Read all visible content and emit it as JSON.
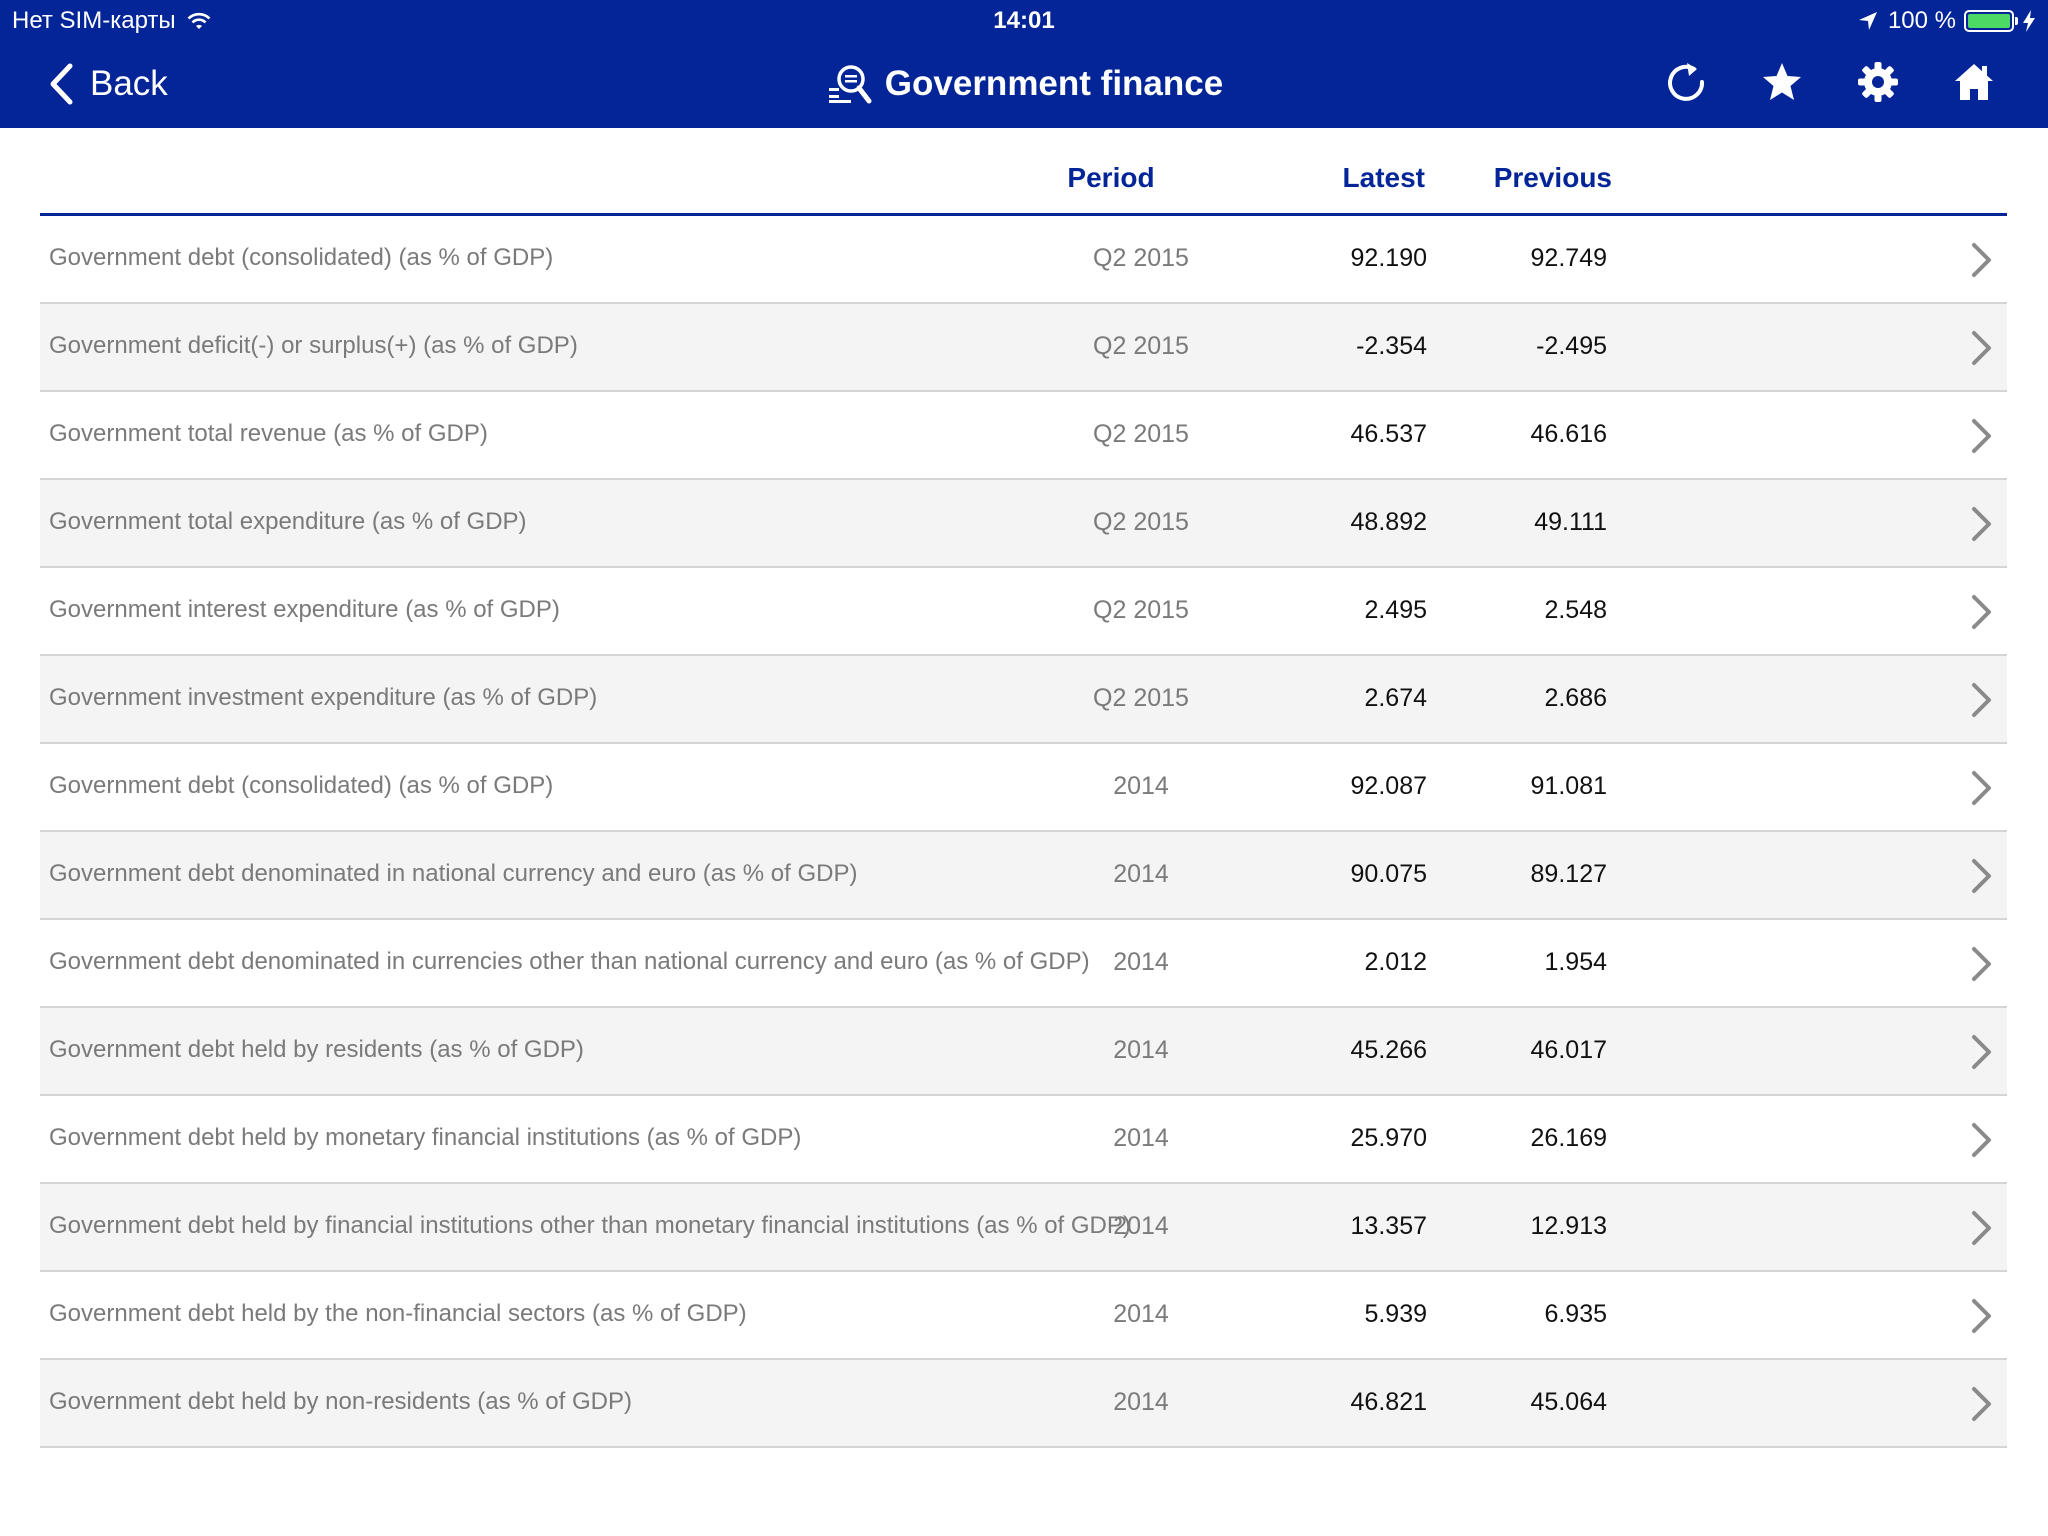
{
  "status_bar": {
    "carrier": "Нет SIM-карты",
    "time": "14:01",
    "battery": "100 %",
    "icons": [
      "wifi-icon",
      "location-arrow-icon",
      "battery-icon",
      "charging-bolt-icon"
    ]
  },
  "nav": {
    "back_label": "Back",
    "title": "Government finance",
    "icons": [
      "back-chevron-icon",
      "search-data-icon",
      "refresh-icon",
      "star-icon",
      "gear-icon",
      "home-icon"
    ]
  },
  "colors": {
    "brand": "#032597",
    "header_text": "#032597",
    "battery": "#4cd964",
    "row_alt": "#f4f4f4"
  },
  "table": {
    "columns": {
      "period": "Period",
      "latest": "Latest",
      "previous": "Previous"
    },
    "rows": [
      {
        "label": "Government debt (consolidated) (as % of GDP)",
        "period": "Q2 2015",
        "latest": "92.190",
        "previous": "92.749"
      },
      {
        "label": "Government deficit(-) or surplus(+) (as % of GDP)",
        "period": "Q2 2015",
        "latest": "-2.354",
        "previous": "-2.495"
      },
      {
        "label": "Government total revenue (as % of GDP)",
        "period": "Q2 2015",
        "latest": "46.537",
        "previous": "46.616"
      },
      {
        "label": "Government total expenditure (as % of GDP)",
        "period": "Q2 2015",
        "latest": "48.892",
        "previous": "49.111"
      },
      {
        "label": "Government interest expenditure (as % of GDP)",
        "period": "Q2 2015",
        "latest": "2.495",
        "previous": "2.548"
      },
      {
        "label": "Government investment expenditure (as % of GDP)",
        "period": "Q2 2015",
        "latest": "2.674",
        "previous": "2.686"
      },
      {
        "label": "Government debt (consolidated) (as % of GDP)",
        "period": "2014",
        "latest": "92.087",
        "previous": "91.081"
      },
      {
        "label": "Government debt denominated in national currency and euro (as % of GDP)",
        "period": "2014",
        "latest": "90.075",
        "previous": "89.127"
      },
      {
        "label": "Government debt denominated in currencies other than national currency and euro (as % of GDP)",
        "period": "2014",
        "latest": "2.012",
        "previous": "1.954"
      },
      {
        "label": "Government debt held by residents (as % of GDP)",
        "period": "2014",
        "latest": "45.266",
        "previous": "46.017"
      },
      {
        "label": "Government debt held by monetary financial institutions (as % of GDP)",
        "period": "2014",
        "latest": "25.970",
        "previous": "26.169"
      },
      {
        "label": "Government debt held by financial institutions other than monetary financial institutions (as % of GDP)",
        "period": "2014",
        "latest": "13.357",
        "previous": "12.913"
      },
      {
        "label": "Government debt held by the non-financial sectors (as % of GDP)",
        "period": "2014",
        "latest": "5.939",
        "previous": "6.935"
      },
      {
        "label": "Government debt held by non-residents (as % of GDP)",
        "period": "2014",
        "latest": "46.821",
        "previous": "45.064"
      }
    ]
  }
}
